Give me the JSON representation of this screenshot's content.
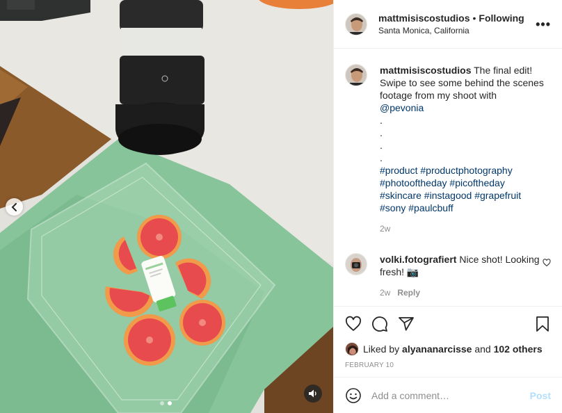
{
  "post": {
    "username": "mattmisiscostudios",
    "follow_status": "Following",
    "location": "Santa Monica, California",
    "more_label": "•••",
    "media_nav": {
      "prev_icon": "chevron-left-icon",
      "carousel_count": 2,
      "active_index": 1,
      "audio_icon": "speaker-icon"
    }
  },
  "caption": {
    "username": "mattmisiscostudios",
    "text": "The final edit! Swipe to see some behind the scenes footage from my shoot with",
    "mention": "@pevonia",
    "dots": [
      ".",
      ".",
      ".",
      "."
    ],
    "hashtags": [
      "#product #productphotography",
      "#photooftheday #picoftheday",
      "#skincare #instagood #grapefruit",
      "#sony #paulcbuff"
    ],
    "time": "2w"
  },
  "comment": {
    "username": "volki.fotografiert",
    "text": "Nice shot! Looking fresh! 📷",
    "time": "2w",
    "reply_label": "Reply"
  },
  "actions": {
    "like_icon": "heart-icon",
    "comment_icon": "comment-bubble-icon",
    "share_icon": "paper-plane-icon",
    "save_icon": "bookmark-icon"
  },
  "likes": {
    "prefix": "Liked by",
    "user": "alyananarcisse",
    "middle": "and",
    "others": "102 others"
  },
  "date": "FEBRUARY 10",
  "add_comment": {
    "emoji_icon": "emoji-smile-icon",
    "placeholder": "Add a comment…",
    "post_label": "Post"
  },
  "colors": {
    "link_blue": "#00376b",
    "post_button": "#0095f6",
    "muted": "#8e8e8e",
    "border": "#efefef"
  }
}
